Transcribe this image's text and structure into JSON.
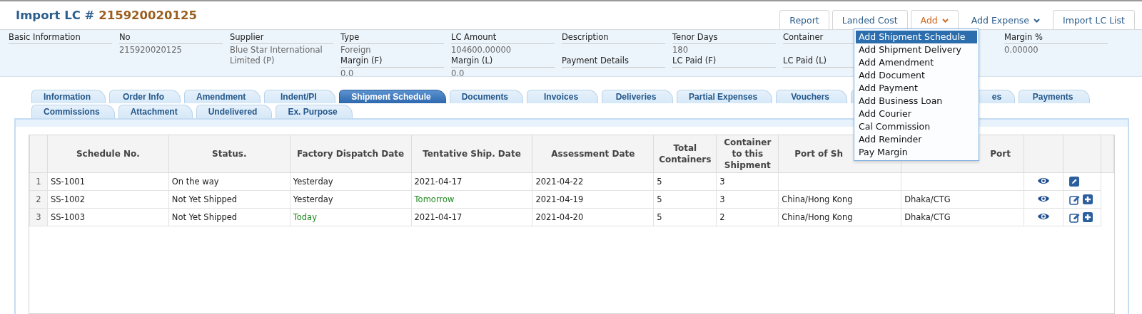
{
  "header": {
    "title": "Import LC #",
    "number": "215920020125",
    "buttons": [
      {
        "label": "Report",
        "bordered": true,
        "caret": false,
        "open": false
      },
      {
        "label": "Landed Cost",
        "bordered": true,
        "caret": false,
        "open": false
      },
      {
        "label": "Add",
        "bordered": true,
        "caret": true,
        "open": true
      },
      {
        "label": "Add Expense",
        "bordered": false,
        "caret": true,
        "open": false
      },
      {
        "label": "Import LC List",
        "bordered": true,
        "caret": false,
        "open": false
      }
    ]
  },
  "info": {
    "columns": [
      {
        "fields": [
          {
            "label": "Basic Information"
          }
        ]
      },
      {
        "fields": [
          {
            "label": "No",
            "value": "215920020125"
          }
        ]
      },
      {
        "fields": [
          {
            "label": "Supplier",
            "value": "Blue Star International Limited (P)"
          }
        ]
      },
      {
        "fields": [
          {
            "label": "Type",
            "value": "Foreign"
          },
          {
            "label": "Margin (F)",
            "value": "0.0"
          }
        ]
      },
      {
        "fields": [
          {
            "label": "LC Amount",
            "value": "104600.00000"
          },
          {
            "label": "Margin (L)",
            "value": "0.0"
          }
        ]
      },
      {
        "fields": [
          {
            "label": "Description"
          },
          {
            "label": "Payment Details"
          }
        ]
      },
      {
        "fields": [
          {
            "label": "Tenor Days",
            "value": "180"
          },
          {
            "label": "LC Paid (F)"
          }
        ]
      },
      {
        "fields": [
          {
            "label": "Container"
          },
          {
            "label": "LC Paid (L)"
          }
        ]
      },
      {
        "fields": [
          {
            "label": "Margin %",
            "value": "0.00000"
          }
        ]
      }
    ]
  },
  "tabs": [
    [
      {
        "label": "Information",
        "selected": false
      },
      {
        "label": "Order Info",
        "selected": false
      },
      {
        "label": "Amendment",
        "selected": false
      },
      {
        "label": "Indent/PI",
        "selected": false
      },
      {
        "label": "Shipment Schedule",
        "selected": true
      },
      {
        "label": "Documents",
        "selected": false
      },
      {
        "label": "Invoices",
        "selected": false
      },
      {
        "label": "Deliveries",
        "selected": false
      },
      {
        "label": "Partial Expenses",
        "selected": false
      },
      {
        "label": "Vouchers",
        "selected": false
      },
      {
        "label": "es",
        "selected": false,
        "clipped": true
      },
      {
        "label": "Payments",
        "selected": false
      }
    ],
    [
      {
        "label": "Commissions",
        "selected": false
      },
      {
        "label": "Attachment",
        "selected": false
      },
      {
        "label": "Undelivered",
        "selected": false
      },
      {
        "label": "Ex. Purpose",
        "selected": false
      }
    ]
  ],
  "table": {
    "columns": [
      {
        "label": "Schedule No."
      },
      {
        "label": "Status."
      },
      {
        "label": "Factory Dispatch Date"
      },
      {
        "label": "Tentative Ship. Date"
      },
      {
        "label": "Assessment Date"
      },
      {
        "label": "Total Containers"
      },
      {
        "label": "Container to this Shipment"
      },
      {
        "label": "Port of Sh",
        "clipped": true
      },
      {
        "label": "Port",
        "clipped": true
      }
    ],
    "rows": [
      {
        "number": "1",
        "cells": [
          "SS-1001",
          "On the way",
          "Yesterday",
          "2021-04-17",
          "2021-04-22",
          "5",
          "3",
          "",
          ""
        ],
        "actions": [
          {
            "kind": "edit-solid"
          }
        ]
      },
      {
        "number": "2",
        "cells": [
          "SS-1002",
          "Not Yet Shipped",
          "Yesterday",
          {
            "text": "Tomorrow",
            "color": "#1e8a1e"
          },
          "2021-04-19",
          "5",
          "3",
          "China/Hong Kong",
          "Dhaka/CTG"
        ],
        "actions": [
          {
            "kind": "edit"
          },
          {
            "kind": "add"
          }
        ]
      },
      {
        "number": "3",
        "cells": [
          "SS-1003",
          "Not Yet Shipped",
          {
            "text": "Today",
            "color": "#1e8a1e"
          },
          "2021-04-17",
          "2021-04-20",
          "5",
          "2",
          "China/Hong Kong",
          "Dhaka/CTG"
        ],
        "actions": [
          {
            "kind": "edit"
          },
          {
            "kind": "add"
          }
        ]
      }
    ]
  },
  "menu": {
    "items": [
      {
        "label": "Add Shipment Schedule",
        "selected": true
      },
      {
        "label": "Add Shipment Delivery",
        "selected": false
      },
      {
        "label": "Add Amendment",
        "selected": false
      },
      {
        "label": "Add Document",
        "selected": false
      },
      {
        "label": "Add Payment",
        "selected": false
      },
      {
        "label": "Add Business Loan",
        "selected": false
      },
      {
        "label": "Add Courier",
        "selected": false
      },
      {
        "label": "Cal Commission",
        "selected": false
      },
      {
        "label": "Add Reminder",
        "selected": false
      },
      {
        "label": "Pay Margin",
        "selected": false
      }
    ]
  }
}
